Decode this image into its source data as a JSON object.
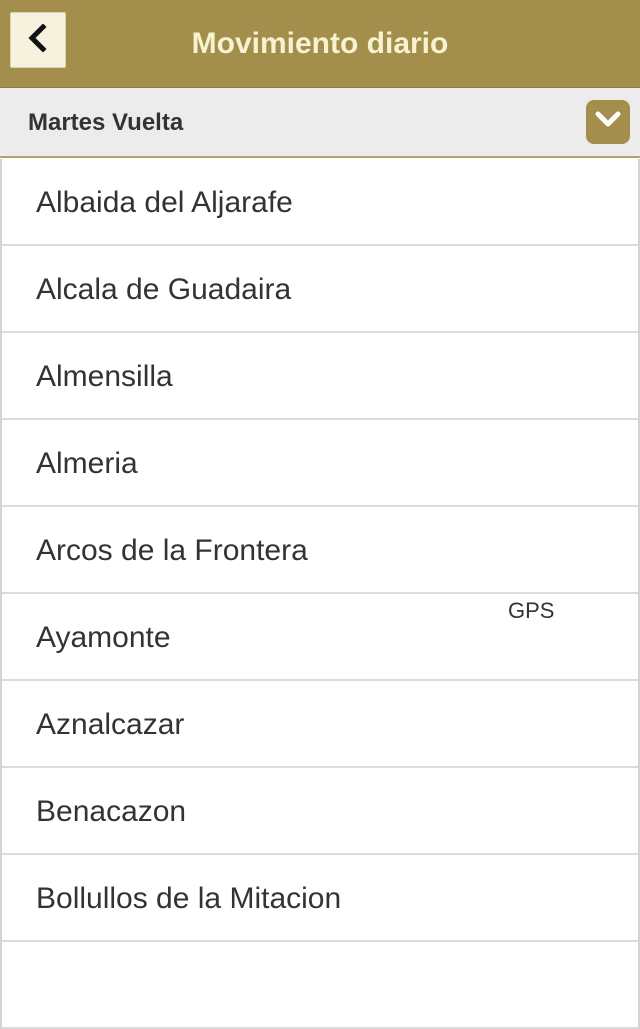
{
  "header": {
    "title": "Movimiento diario",
    "back_icon": "chevron-left-icon"
  },
  "subbar": {
    "label": "Martes Vuelta",
    "dropdown_icon": "chevron-down-icon"
  },
  "colors": {
    "header_bg": "#a48e4b",
    "title_text": "#f7f2cf",
    "subbar_bg": "#ececec"
  },
  "list": {
    "items": [
      {
        "label": "Albaida del Aljarafe",
        "badge": ""
      },
      {
        "label": "Alcala de Guadaira",
        "badge": ""
      },
      {
        "label": "Almensilla",
        "badge": ""
      },
      {
        "label": "Almeria",
        "badge": ""
      },
      {
        "label": "Arcos de la Frontera",
        "badge": ""
      },
      {
        "label": "Ayamonte",
        "badge": "GPS"
      },
      {
        "label": "Aznalcazar",
        "badge": ""
      },
      {
        "label": "Benacazon",
        "badge": ""
      },
      {
        "label": "Bollullos de la Mitacion",
        "badge": ""
      }
    ]
  }
}
